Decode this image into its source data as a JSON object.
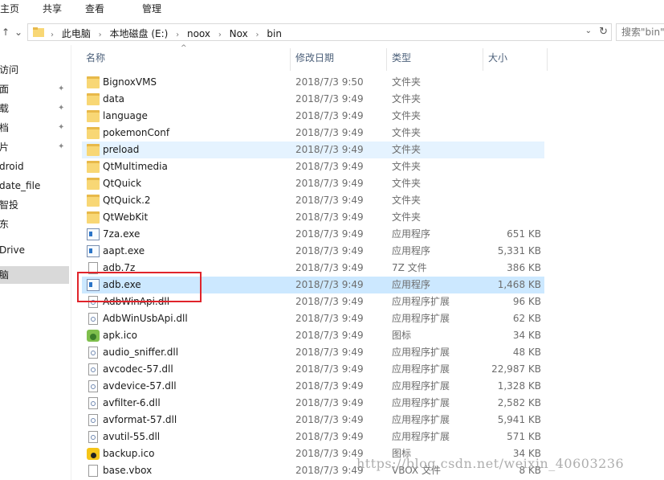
{
  "ribbon": {
    "tabs": [
      "主页",
      "共享",
      "查看",
      "管理"
    ]
  },
  "address": {
    "crumbs": [
      "此电脑",
      "本地磁盘 (E:)",
      "noox",
      "Nox",
      "bin"
    ],
    "search_placeholder": "搜索\"bin\""
  },
  "sidebar": {
    "items": [
      {
        "label": "访问",
        "pinned": false
      },
      {
        "label": "面",
        "pinned": true
      },
      {
        "label": "载",
        "pinned": true
      },
      {
        "label": "档",
        "pinned": true
      },
      {
        "label": "片",
        "pinned": true
      },
      {
        "label": "droid",
        "pinned": false
      },
      {
        "label": "date_file",
        "pinned": false
      },
      {
        "label": "智投",
        "pinned": false
      },
      {
        "label": "东",
        "pinned": false
      },
      {
        "label": "Drive",
        "pinned": false
      },
      {
        "label": "脑",
        "pinned": false,
        "selected": true
      }
    ]
  },
  "columns": {
    "name": "名称",
    "date": "修改日期",
    "type": "类型",
    "size": "大小"
  },
  "files": [
    {
      "name": "BignoxVMS",
      "date": "2018/7/3 9:50",
      "type": "文件夹",
      "size": "",
      "icon": "folder-icon"
    },
    {
      "name": "data",
      "date": "2018/7/3 9:49",
      "type": "文件夹",
      "size": "",
      "icon": "folder-icon"
    },
    {
      "name": "language",
      "date": "2018/7/3 9:49",
      "type": "文件夹",
      "size": "",
      "icon": "folder-icon"
    },
    {
      "name": "pokemonConf",
      "date": "2018/7/3 9:49",
      "type": "文件夹",
      "size": "",
      "icon": "folder-icon"
    },
    {
      "name": "preload",
      "date": "2018/7/3 9:49",
      "type": "文件夹",
      "size": "",
      "icon": "folder-icon",
      "state": "hover"
    },
    {
      "name": "QtMultimedia",
      "date": "2018/7/3 9:49",
      "type": "文件夹",
      "size": "",
      "icon": "folder-icon"
    },
    {
      "name": "QtQuick",
      "date": "2018/7/3 9:49",
      "type": "文件夹",
      "size": "",
      "icon": "folder-icon"
    },
    {
      "name": "QtQuick.2",
      "date": "2018/7/3 9:49",
      "type": "文件夹",
      "size": "",
      "icon": "folder-icon"
    },
    {
      "name": "QtWebKit",
      "date": "2018/7/3 9:49",
      "type": "文件夹",
      "size": "",
      "icon": "folder-icon"
    },
    {
      "name": "7za.exe",
      "date": "2018/7/3 9:49",
      "type": "应用程序",
      "size": "651 KB",
      "icon": "exe-icon"
    },
    {
      "name": "aapt.exe",
      "date": "2018/7/3 9:49",
      "type": "应用程序",
      "size": "5,331 KB",
      "icon": "exe-icon"
    },
    {
      "name": "adb.7z",
      "date": "2018/7/3 9:49",
      "type": "7Z 文件",
      "size": "386 KB",
      "icon": "file-icon"
    },
    {
      "name": "adb.exe",
      "date": "2018/7/3 9:49",
      "type": "应用程序",
      "size": "1,468 KB",
      "icon": "exe-icon",
      "state": "selected"
    },
    {
      "name": "AdbWinApi.dll",
      "date": "2018/7/3 9:49",
      "type": "应用程序扩展",
      "size": "96 KB",
      "icon": "dll-icon"
    },
    {
      "name": "AdbWinUsbApi.dll",
      "date": "2018/7/3 9:49",
      "type": "应用程序扩展",
      "size": "62 KB",
      "icon": "dll-icon"
    },
    {
      "name": "apk.ico",
      "date": "2018/7/3 9:49",
      "type": "图标",
      "size": "34 KB",
      "icon": "image-icon"
    },
    {
      "name": "audio_sniffer.dll",
      "date": "2018/7/3 9:49",
      "type": "应用程序扩展",
      "size": "48 KB",
      "icon": "dll-icon"
    },
    {
      "name": "avcodec-57.dll",
      "date": "2018/7/3 9:49",
      "type": "应用程序扩展",
      "size": "22,987 KB",
      "icon": "dll-icon"
    },
    {
      "name": "avdevice-57.dll",
      "date": "2018/7/3 9:49",
      "type": "应用程序扩展",
      "size": "1,328 KB",
      "icon": "dll-icon"
    },
    {
      "name": "avfilter-6.dll",
      "date": "2018/7/3 9:49",
      "type": "应用程序扩展",
      "size": "2,582 KB",
      "icon": "dll-icon"
    },
    {
      "name": "avformat-57.dll",
      "date": "2018/7/3 9:49",
      "type": "应用程序扩展",
      "size": "5,941 KB",
      "icon": "dll-icon"
    },
    {
      "name": "avutil-55.dll",
      "date": "2018/7/3 9:49",
      "type": "应用程序扩展",
      "size": "571 KB",
      "icon": "dll-icon"
    },
    {
      "name": "backup.ico",
      "date": "2018/7/3 9:49",
      "type": "图标",
      "size": "34 KB",
      "icon": "image-icon-2"
    },
    {
      "name": "base.vbox",
      "date": "2018/7/3 9:49",
      "type": "VBOX 文件",
      "size": "8 KB",
      "icon": "file-icon"
    }
  ],
  "watermark": "https://blog.csdn.net/weixin_40603236",
  "colors": {
    "hover": "#e5f3ff",
    "selected": "#cce8ff",
    "annotation": "#e0242b"
  }
}
